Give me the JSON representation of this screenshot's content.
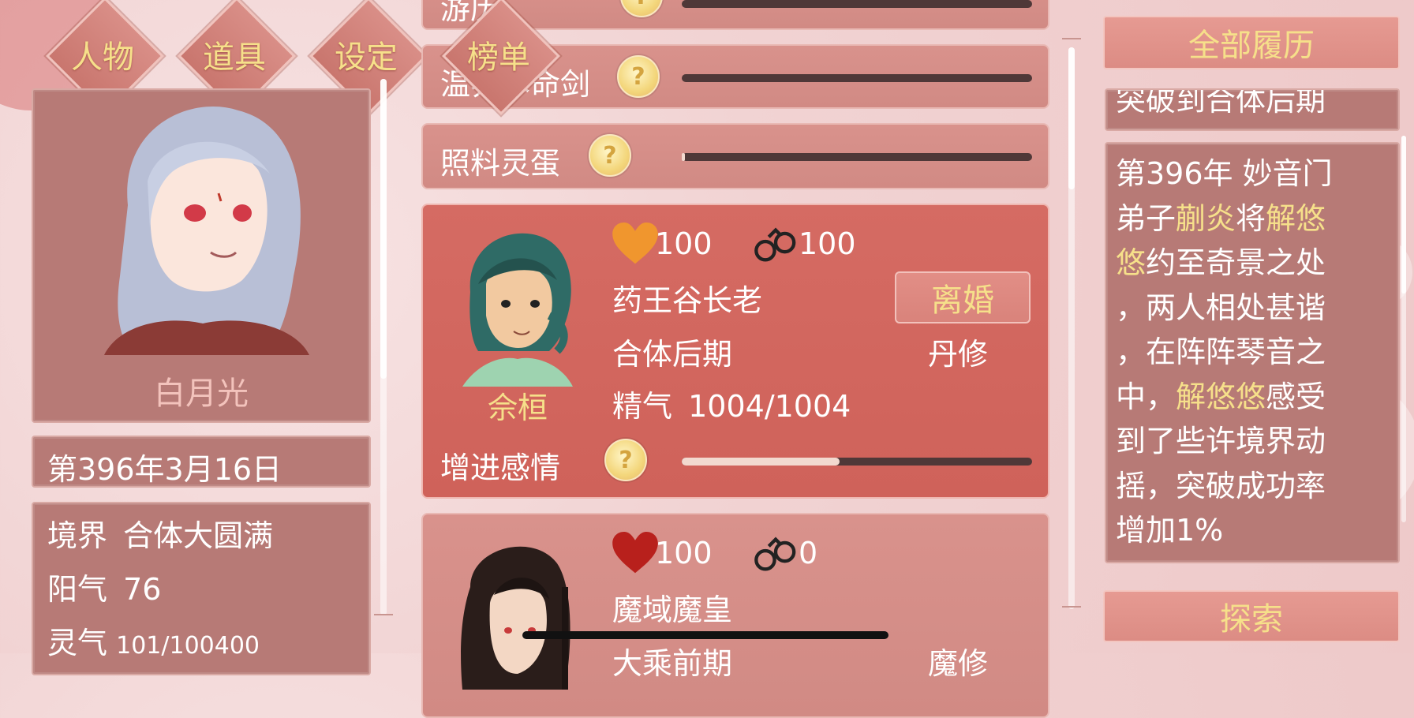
{
  "nav": {
    "tabs": [
      {
        "label": "人物"
      },
      {
        "label": "道具"
      },
      {
        "label": "设定"
      },
      {
        "label": "榜单"
      }
    ]
  },
  "character": {
    "name": "白月光",
    "date": "第396年3月16日",
    "stats": {
      "realm_label": "境界",
      "realm_value": "合体大圆满",
      "yang_label": "阳气",
      "yang_value": "76",
      "lingqi_label": "灵气",
      "lingqi_value": "101/100400"
    }
  },
  "tasks": {
    "top_partial": {
      "label": "游历",
      "progress": 0
    },
    "items": [
      {
        "label": "温养本命剑",
        "progress": 0
      },
      {
        "label": "照料灵蛋",
        "progress": 0.01
      }
    ]
  },
  "partners": [
    {
      "name": "佘桓",
      "affection": "100",
      "bond": "100",
      "title": "药王谷长老",
      "realm": "合体后期",
      "type": "丹修",
      "essence_label": "精气",
      "essence_value": "1004/1004",
      "action_label": "增进感情",
      "action_progress": 0.45,
      "divorce_label": "离婚",
      "heart_color": "#f0962e"
    },
    {
      "affection": "100",
      "bond": "0",
      "title": "魔域魔皇",
      "realm_partial": "大乘前期",
      "type_partial": "魔修",
      "heart_color": "#b8201c"
    }
  ],
  "history": {
    "header": "全部履历",
    "partial_line": "突破到合体后期",
    "entry": {
      "l1": "第396年 妙音门",
      "l2_a": "弟子",
      "l2_name1": "蒯炎",
      "l2_b": "将",
      "l2_name2a": "解悠",
      "l3_name2b": "悠",
      "l3_a": "约至奇景之处",
      "l4": "，两人相处甚谐",
      "l5": "，在阵阵琴音之",
      "l6_a": "中，",
      "l6_name": "解悠悠",
      "l6_b": "感受",
      "l7": "到了些许境界动",
      "l8": "摇，突破成功率",
      "l9": "增加1%"
    },
    "explore_button": "探索"
  },
  "colors": {
    "gold_text": "#f6e08a",
    "panel_brown": "#b77a76",
    "active_card": "#d56b63"
  }
}
